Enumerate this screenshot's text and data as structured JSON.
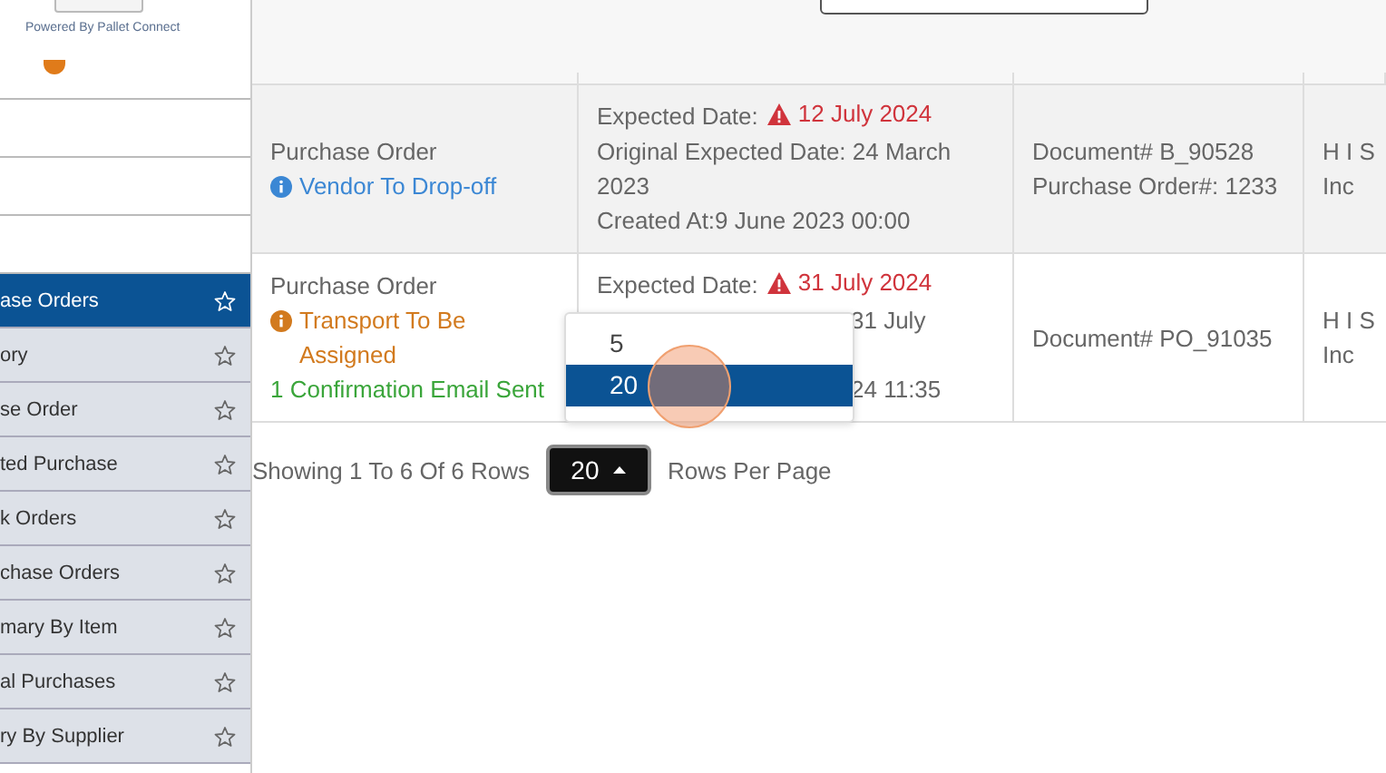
{
  "sidebar": {
    "powered_by": "Powered By Pallet Connect",
    "items": [
      {
        "label": "ase Orders",
        "selected": true
      },
      {
        "label": "ory",
        "selected": false
      },
      {
        "label": "se Order",
        "selected": false
      },
      {
        "label": "ted Purchase",
        "selected": false
      },
      {
        "label": "k Orders",
        "selected": false
      },
      {
        "label": "chase Orders",
        "selected": false
      },
      {
        "label": "mary By Item",
        "selected": false
      },
      {
        "label": "al Purchases",
        "selected": false
      },
      {
        "label": "ry By Supplier",
        "selected": false
      }
    ]
  },
  "table": {
    "rows": [
      {
        "type": "Purchase Order",
        "statuses": [
          {
            "kind": "info",
            "text": "Vendor To Drop-off",
            "color": "#3b87d4"
          }
        ],
        "dates": [
          {
            "kind": "warning",
            "label": "Expected Date:",
            "value": "12 July 2024"
          },
          {
            "kind": "plain",
            "text": "Original Expected Date: 24 March 2023"
          },
          {
            "kind": "plain",
            "text": "Created At:9 June 2023 00:00"
          }
        ],
        "document": [
          "Document# B_90528",
          "Purchase Order#: 1233"
        ],
        "supplier": [
          "H I S",
          "Inc"
        ]
      },
      {
        "type": "Purchase Order",
        "statuses": [
          {
            "kind": "info",
            "text": "Transport To Be Assigned",
            "color": "#d27a1e"
          },
          {
            "kind": "note",
            "text": "1 Confirmation Email Sent",
            "color": "#3aa53a"
          }
        ],
        "dates": [
          {
            "kind": "warning",
            "label": "Expected Date:",
            "value": "31 July 2024"
          },
          {
            "kind": "partial",
            "text": "31 July"
          },
          {
            "kind": "partial-after-gap",
            "text": "24 11:35"
          }
        ],
        "document": [
          "Document# PO_91035"
        ],
        "supplier": [
          "H I S",
          "Inc"
        ]
      }
    ]
  },
  "pagination": {
    "summary": "Showing 1 To 6 Of 6 Rows",
    "page_size": "20",
    "suffix": "Rows Per Page",
    "options": [
      {
        "label": "5",
        "selected": false
      },
      {
        "label": "20",
        "selected": true
      }
    ]
  }
}
